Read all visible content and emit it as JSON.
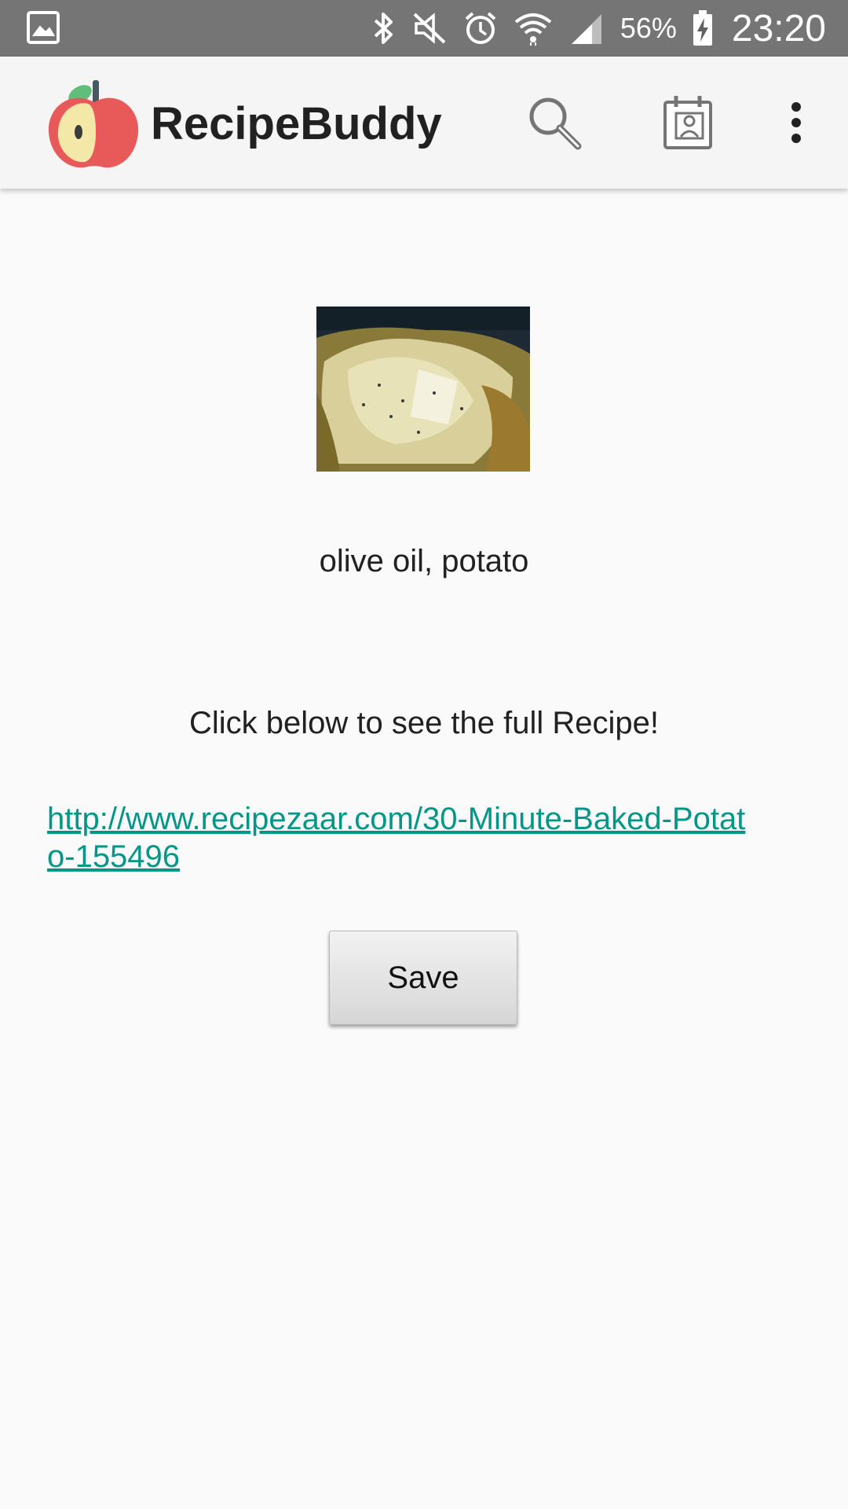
{
  "status_bar": {
    "battery_percent": "56%",
    "time": "23:20",
    "icons": [
      "gallery-icon",
      "bluetooth-icon",
      "mute-icon",
      "alarm-icon",
      "wifi-icon",
      "signal-icon",
      "battery-charging-icon"
    ]
  },
  "app_bar": {
    "title": "RecipeBuddy",
    "logo": "apple-logo-icon",
    "actions": [
      "search-icon",
      "calendar-contact-icon",
      "overflow-menu-icon"
    ]
  },
  "recipe": {
    "ingredients": "olive oil, potato",
    "prompt": "Click below to see the full Recipe!",
    "link": "http://www.recipezaar.com/30-Minute-Baked-Potato-155496",
    "save_label": "Save"
  },
  "colors": {
    "status_bar": "#757575",
    "app_bar": "#f5f5f5",
    "background": "#fafafa",
    "link": "#009688"
  }
}
